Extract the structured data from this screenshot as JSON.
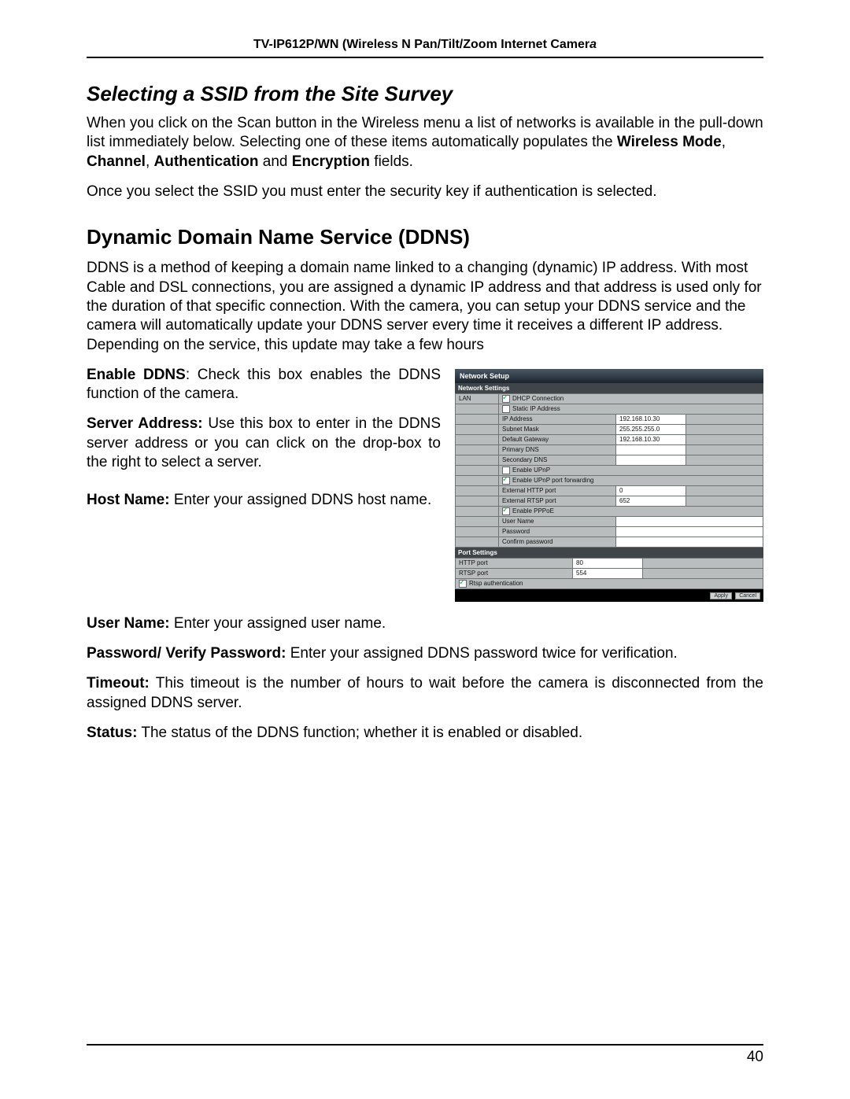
{
  "header": {
    "model": "TV-IP612P/WN (Wireless N Pan/Tilt/Zoom Internet Camer",
    "model_ital": "a"
  },
  "h_ssid": "Selecting a SSID from the Site Survey",
  "p_ssid_1a": "When you click on the Scan button in the Wireless menu a list of networks is available in the pull-down list immediately below. Selecting one of these items automatically populates the ",
  "p_ssid_1b": "Wireless Mode",
  "p_ssid_1c": ", ",
  "p_ssid_1d": "Channel",
  "p_ssid_1e": ", ",
  "p_ssid_1f": "Authentication",
  "p_ssid_1g": " and ",
  "p_ssid_1h": "Encryption",
  "p_ssid_1i": " fields.",
  "p_ssid_2": "Once you select the SSID you must enter the security key if authentication is selected.",
  "h_ddns": "Dynamic Domain Name Service (DDNS)",
  "p_ddns_intro": "DDNS is a method of keeping a domain name linked to a changing (dynamic) IP address. With most Cable and DSL connections, you are assigned a dynamic IP address and that address is used only for the duration of that specific connection. With the camera, you can setup your DDNS service and the camera will automatically update your DDNS server every time it receives a different IP address. Depending on the service, this update may take a few hours",
  "f_enable_l": "Enable DDNS",
  "f_enable_t": ": Check this box enables the DDNS function of the camera.",
  "f_server_l": "Server Address:",
  "f_server_t": " Use this box to enter in the DDNS server address or you can click on the drop-box to the right to select a server.",
  "f_host_l": "Host Name:",
  "f_host_t": " Enter your assigned DDNS host name.",
  "f_user_l": "User Name:",
  "f_user_t": " Enter your assigned user name.",
  "f_pass_l": "Password/ Verify Password:",
  "f_pass_t": " Enter your assigned DDNS password twice for verification.",
  "f_timeout_l": "Timeout:",
  "f_timeout_t": " This timeout is the number of hours to wait before the camera is disconnected from the assigned DDNS server.",
  "f_status_l": "Status:",
  "f_status_t": " The status of the DDNS function; whether it is enabled or disabled.",
  "shot": {
    "title": "Network Setup",
    "sec1": "Network Settings",
    "lan": "LAN",
    "dhcp": "DHCP Connection",
    "static": "Static IP Address",
    "ip_l": "IP Address",
    "ip_v": "192.168.10.30",
    "sm_l": "Subnet Mask",
    "sm_v": "255.255.255.0",
    "gw_l": "Default Gateway",
    "gw_v": "192.168.10.30",
    "pdns_l": "Primary DNS",
    "sdns_l": "Secondary DNS",
    "upnp": "Enable UPnP",
    "upnpf": "Enable UPnP port forwarding",
    "ehttp_l": "External HTTP port",
    "ehttp_v": "0",
    "ertsp_l": "External RTSP port",
    "ertsp_v": "652",
    "pppoe": "Enable PPPoE",
    "un_l": "User Name",
    "pw_l": "Password",
    "cpw_l": "Confirm password",
    "sec2": "Port Settings",
    "http_l": "HTTP port",
    "http_v": "80",
    "rtsp_l": "RTSP port",
    "rtsp_v": "554",
    "rtspauth": "Rtsp authentication",
    "btn1": "Apply",
    "btn2": "Cancel"
  },
  "pagenum": "40"
}
